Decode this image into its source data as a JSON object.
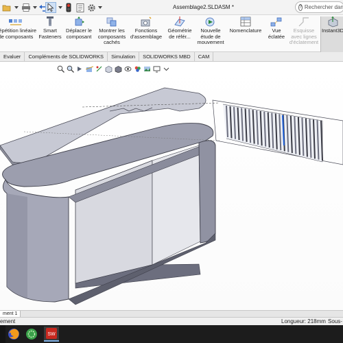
{
  "window": {
    "title": "Assemblage2.SLDASM *",
    "search_placeholder": "Rechercher dans"
  },
  "quick_access": {
    "icons": [
      "open-folder-icon",
      "print-icon",
      "undo-icon",
      "select-arrow-icon",
      "traffic-light-icon",
      "file-properties-icon",
      "options-gear-icon"
    ]
  },
  "ribbon": {
    "buttons": [
      {
        "label": "Répétition linéaire\nde composants",
        "icon": "linear-pattern-icon",
        "enabled": true
      },
      {
        "label": "Smart\nFasteners",
        "icon": "smart-fasteners-icon",
        "enabled": true
      },
      {
        "label": "Déplacer le\ncomposant",
        "icon": "move-component-icon",
        "enabled": true
      },
      {
        "label": "Montrer les\ncomposants\ncachés",
        "icon": "show-hidden-icon",
        "enabled": true
      },
      {
        "label": "Fonctions\nd'assemblage",
        "icon": "assembly-features-icon",
        "enabled": true
      },
      {
        "label": "Géométrie\nde référ...",
        "icon": "reference-geometry-icon",
        "enabled": true
      },
      {
        "label": "Nouvelle\nétude de\nmouvement",
        "icon": "motion-study-icon",
        "enabled": true
      },
      {
        "label": "Nomenclature",
        "icon": "bom-icon",
        "enabled": true
      },
      {
        "label": "Vue\néclatée",
        "icon": "exploded-view-icon",
        "enabled": true
      },
      {
        "label": "Esquisse\navec lignes\nd'éclatement",
        "icon": "explode-line-sketch-icon",
        "enabled": false
      },
      {
        "label": "Instant3D",
        "icon": "instant3d-icon",
        "enabled": true,
        "active": true
      }
    ]
  },
  "tabs": [
    "Evaluer",
    "Compléments de SOLIDWORKS",
    "Simulation",
    "SOLIDWORKS MBD",
    "CAM"
  ],
  "heads_up_toolbar": {
    "icons": [
      "zoom-fit-icon",
      "zoom-area-icon",
      "previous-view-icon",
      "section-view-icon",
      "dynamic-annotation-icon",
      "view-orientation-icon",
      "display-style-icon",
      "hide-show-icon",
      "edit-appearance-icon",
      "apply-scene-icon",
      "view-settings-icon",
      "monitor-icon"
    ]
  },
  "document_tabs": [
    "ment 1"
  ],
  "status": {
    "left": "ement",
    "length": "Longueur: 218mm",
    "right": "Sous-"
  },
  "taskbar": {
    "items": [
      "firefox-icon",
      "green-app-icon",
      "solidworks-icon"
    ],
    "active": "solidworks-icon"
  },
  "colors": {
    "model_fill": "#a8aab8",
    "model_shade": "#7c7e8e",
    "model_dark": "#4a4b57",
    "selection_accent": "#1f5fd6"
  }
}
